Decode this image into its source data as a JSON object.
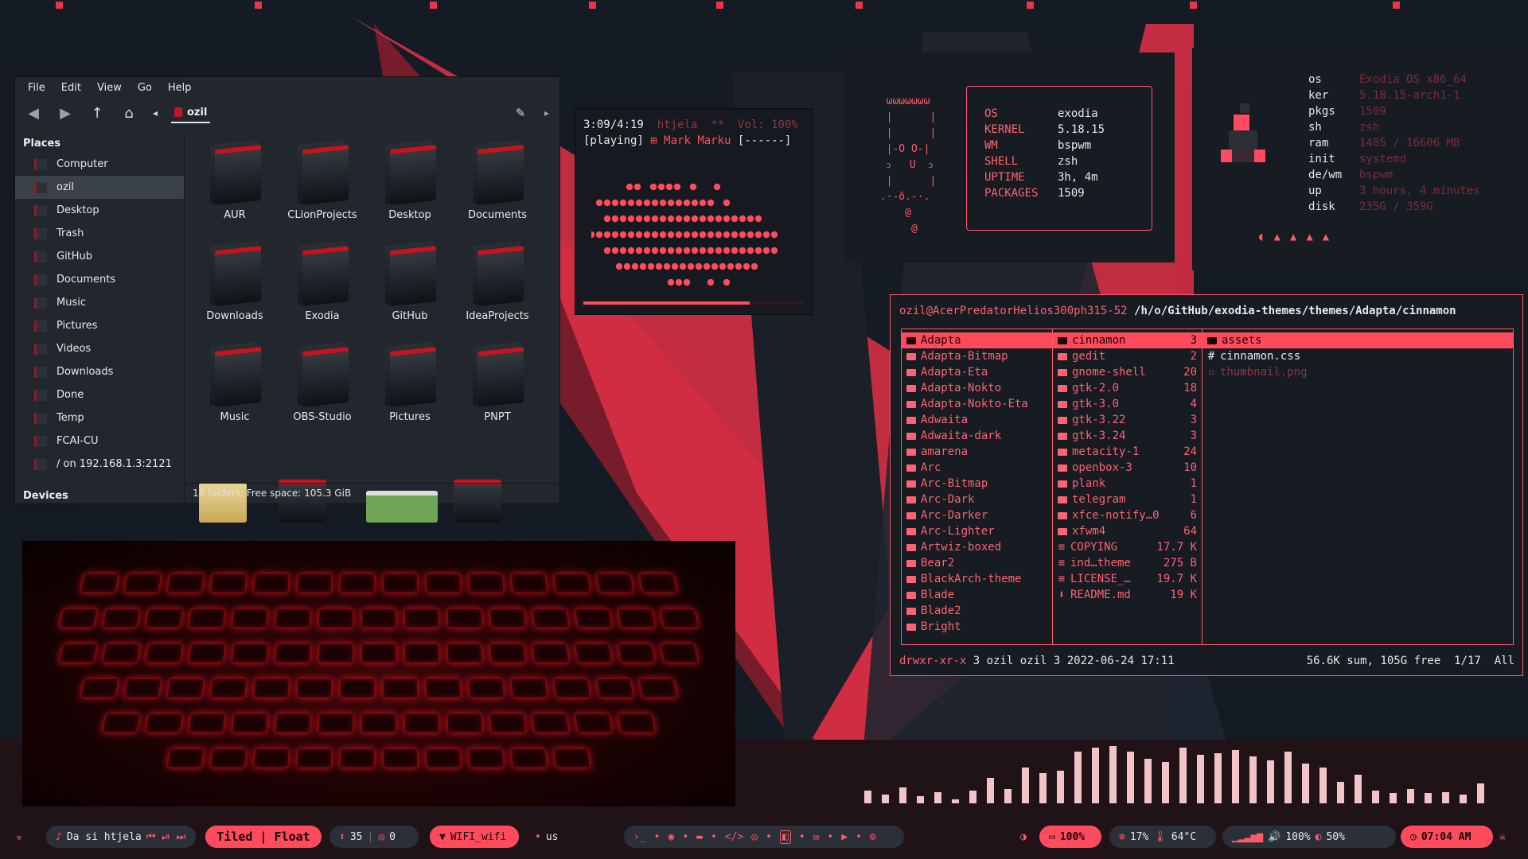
{
  "colors": {
    "accent": "#ff4b5c",
    "panel": "#171b22",
    "fm_bg": "#22272e"
  },
  "file_manager": {
    "menu": [
      "File",
      "Edit",
      "View",
      "Go",
      "Help"
    ],
    "toolbar_icons": [
      "back-icon",
      "forward-icon",
      "up-arrow-icon",
      "home-icon",
      "chevron-left-icon",
      "edit-pencil-icon",
      "chevron-right-icon"
    ],
    "current_folder": "ozil",
    "places_heading": "Places",
    "devices_heading": "Devices",
    "places": [
      {
        "label": "Computer"
      },
      {
        "label": "ozil"
      },
      {
        "label": "Desktop"
      },
      {
        "label": "Trash"
      },
      {
        "label": "GitHub"
      },
      {
        "label": "Documents"
      },
      {
        "label": "Music"
      },
      {
        "label": "Pictures"
      },
      {
        "label": "Videos"
      },
      {
        "label": "Downloads"
      },
      {
        "label": "Done"
      },
      {
        "label": "Temp"
      },
      {
        "label": "FCAI-CU"
      },
      {
        "label": "/ on 192.168.1.3:2121"
      }
    ],
    "folders": [
      "AUR",
      "CLionProjects",
      "Desktop",
      "Documents",
      "Downloads",
      "Exodia",
      "GitHub",
      "IdeaProjects",
      "Music",
      "OBS-Studio",
      "Pictures",
      "PNPT"
    ],
    "status": "18 folders, Free space: 105.3 GiB"
  },
  "player": {
    "line1_time": "3:09/4:19",
    "line1_user": "htjela",
    "line1_stars": "**",
    "line1_vol": "Vol: 100%",
    "line2_state": "[playing]",
    "line2_track": "Mark Marku",
    "line2_bar": "[------]",
    "progress": 0.75
  },
  "neofetch1": {
    "art": "  ωωωωωωω\n  |      |\n  |      |\n  |-O O-|\n  ↄ   U  ↄ\n  |      |\n .·-ö.-·.\n     @\n      @",
    "rows": [
      {
        "k": "OS",
        "v": "exodia"
      },
      {
        "k": "KERNEL",
        "v": "5.18.15"
      },
      {
        "k": "WM",
        "v": "bspwm"
      },
      {
        "k": "SHELL",
        "v": "zsh"
      },
      {
        "k": "UPTIME",
        "v": "3h, 4m"
      },
      {
        "k": "PACKAGES",
        "v": "1509"
      }
    ]
  },
  "neofetch2": {
    "rows": [
      {
        "k": "os",
        "v": "Exodia OS x86_64"
      },
      {
        "k": "ker",
        "v": "5.18.15-arch1-1"
      },
      {
        "k": "pkgs",
        "v": "1509"
      },
      {
        "k": "sh",
        "v": "zsh"
      },
      {
        "k": "ram",
        "v": "1485 / 16606 MB"
      },
      {
        "k": "init",
        "v": "systemd"
      },
      {
        "k": "de/wm",
        "v": "bspwm"
      },
      {
        "k": "up",
        "v": "3 hours, 4 minutes"
      },
      {
        "k": "disk",
        "v": "235G / 359G"
      }
    ],
    "ghosts": [
      "pacman-icon",
      "ghost-icon",
      "ghost-icon",
      "ghost-icon",
      "ghost-icon"
    ]
  },
  "ranger": {
    "prompt": "ozil@AcerPredatorHelios300ph315-52",
    "path": "/h/o/GitHub/exodia-themes/themes/Adapta/cinnamon",
    "col1": [
      "Adapta",
      "Adapta-Bitmap",
      "Adapta-Eta",
      "Adapta-Nokto",
      "Adapta-Nokto-Eta",
      "Adwaita",
      "Adwaita-dark",
      "amarena",
      "Arc",
      "Arc-Bitmap",
      "Arc-Dark",
      "Arc-Darker",
      "Arc-Lighter",
      "Artwiz-boxed",
      "Bear2",
      "BlackArch-theme",
      "Blade",
      "Blade2",
      "Bright"
    ],
    "col2": [
      {
        "n": "cinnamon",
        "c": "3",
        "t": "dir"
      },
      {
        "n": "gedit",
        "c": "2",
        "t": "dir"
      },
      {
        "n": "gnome-shell",
        "c": "20",
        "t": "dir"
      },
      {
        "n": "gtk-2.0",
        "c": "18",
        "t": "dir"
      },
      {
        "n": "gtk-3.0",
        "c": "4",
        "t": "dir"
      },
      {
        "n": "gtk-3.22",
        "c": "3",
        "t": "dir"
      },
      {
        "n": "gtk-3.24",
        "c": "3",
        "t": "dir"
      },
      {
        "n": "metacity-1",
        "c": "24",
        "t": "dir"
      },
      {
        "n": "openbox-3",
        "c": "10",
        "t": "dir"
      },
      {
        "n": "plank",
        "c": "1",
        "t": "dir"
      },
      {
        "n": "telegram",
        "c": "1",
        "t": "dir"
      },
      {
        "n": "xfce-notify…0",
        "c": "6",
        "t": "dir"
      },
      {
        "n": "xfwm4",
        "c": "64",
        "t": "dir"
      },
      {
        "n": "COPYING",
        "c": "17.7 K",
        "t": "file"
      },
      {
        "n": "ind…theme",
        "c": "275 B",
        "t": "file"
      },
      {
        "n": "LICENSE_…",
        "c": "19.7 K",
        "t": "file"
      },
      {
        "n": "README.md",
        "c": "19 K",
        "t": "md"
      }
    ],
    "col3": [
      {
        "n": "assets",
        "t": "dir"
      },
      {
        "n": "cinnamon.css",
        "t": "css"
      },
      {
        "n": "thumbnail.png",
        "t": "img"
      }
    ],
    "foot_perm": "drwxr-xr-x",
    "foot_info": " 3 ozil ozil 3 2022-06-24 17:11",
    "foot_right": "56.6K sum, 105G free  1/17  All"
  },
  "cava": [
    0.18,
    0.12,
    0.22,
    0.1,
    0.16,
    0.06,
    0.18,
    0.36,
    0.2,
    0.5,
    0.42,
    0.45,
    0.72,
    0.78,
    0.8,
    0.72,
    0.62,
    0.58,
    0.78,
    0.68,
    0.7,
    0.74,
    0.66,
    0.6,
    0.72,
    0.56,
    0.5,
    0.3,
    0.4,
    0.18,
    0.14,
    0.2,
    0.14,
    0.16,
    0.12,
    0.28
  ],
  "bar": {
    "media_label": "Da si htjela",
    "layout_label": "Tiled | Float",
    "updates": "35",
    "github": "0",
    "wifi": "WIFI_wifi",
    "kbd": "us",
    "battery": "100%",
    "cpu": "17%",
    "temp": "64°C",
    "volume": "100%",
    "brightness": "50%",
    "clock": "07:04 AM"
  }
}
